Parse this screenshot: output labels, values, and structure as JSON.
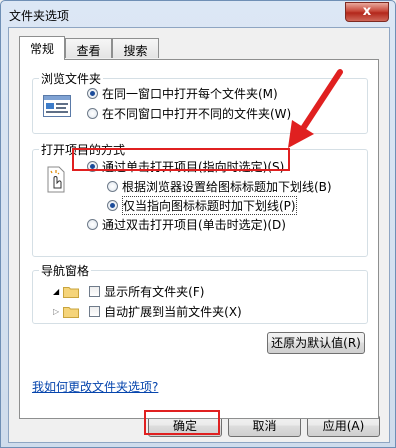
{
  "window": {
    "title": "文件夹选项",
    "close_label": "x"
  },
  "tabs": [
    {
      "label": "常规"
    },
    {
      "label": "查看"
    },
    {
      "label": "搜索"
    }
  ],
  "browse_group": {
    "title": "浏览文件夹",
    "options": [
      {
        "label": "在同一窗口中打开每个文件夹(M)",
        "selected": true
      },
      {
        "label": "在不同窗口中打开不同的文件夹(W)",
        "selected": false
      }
    ]
  },
  "click_group": {
    "title": "打开项目的方式",
    "options": [
      {
        "label": "通过单击打开项目(指向时选定)(S)",
        "selected": true
      },
      {
        "label": "根据浏览器设置给图标标题加下划线(B)",
        "selected": false
      },
      {
        "label": "仅当指向图标标题时加下划线(P)",
        "selected": true
      },
      {
        "label": "通过双击打开项目(单击时选定)(D)",
        "selected": false
      }
    ]
  },
  "nav_group": {
    "title": "导航窗格",
    "options": [
      {
        "label": "显示所有文件夹(F)",
        "checked": false
      },
      {
        "label": "自动扩展到当前文件夹(X)",
        "checked": false
      }
    ]
  },
  "restore_button": "还原为默认值(R)",
  "help_link": "我如何更改文件夹选项?",
  "footer": {
    "ok": "确定",
    "cancel": "取消",
    "apply": "应用(A)"
  },
  "annotation_color": "#e02020"
}
